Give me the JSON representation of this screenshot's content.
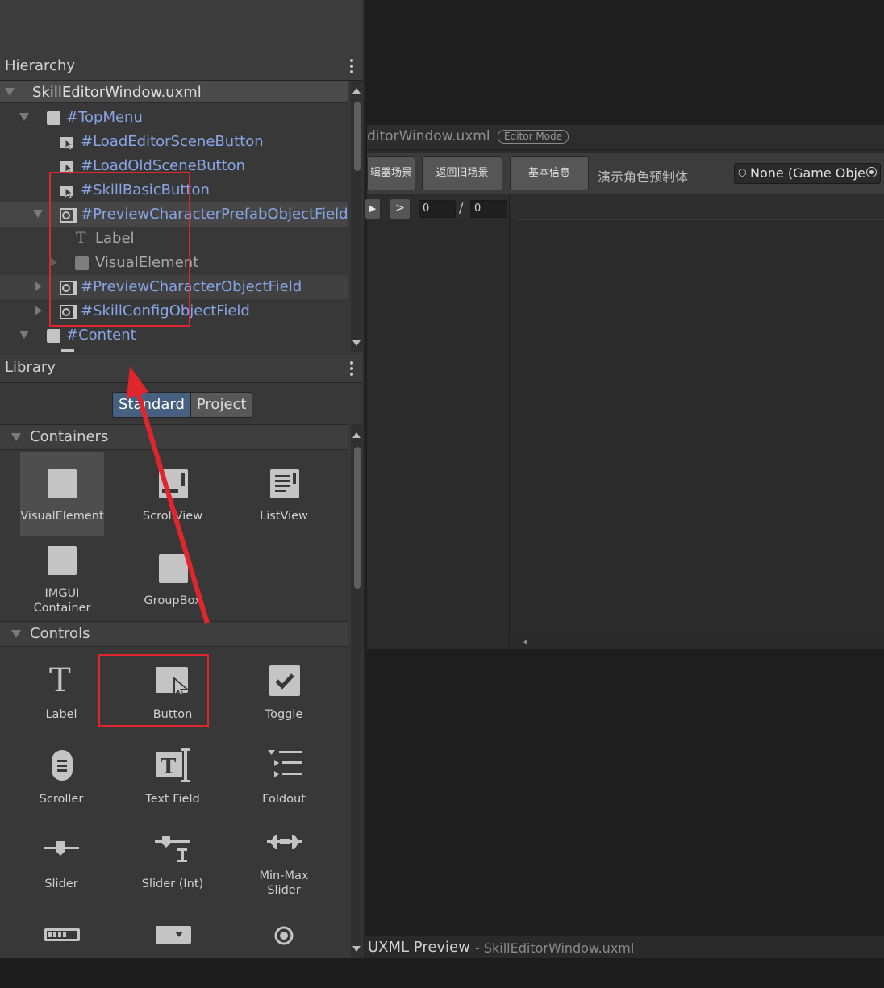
{
  "hierarchy": {
    "title": "Hierarchy",
    "root": "SkillEditorWindow.uxml",
    "rows": [
      {
        "label": "#TopMenu"
      },
      {
        "label": "#LoadEditorSceneButton"
      },
      {
        "label": "#LoadOldSceneButton"
      },
      {
        "label": "#SkillBasicButton"
      },
      {
        "label": "#PreviewCharacterPrefabObjectField"
      },
      {
        "label": "Label"
      },
      {
        "label": "VisualElement"
      },
      {
        "label": "#PreviewCharacterObjectField"
      },
      {
        "label": "#SkillConfigObjectField"
      },
      {
        "label": "#Content"
      }
    ]
  },
  "library": {
    "title": "Library",
    "tabs": {
      "standard": "Standard",
      "project": "Project"
    },
    "containers": {
      "title": "Containers",
      "items": [
        "VisualElement",
        "ScrollView",
        "ListView",
        "IMGUI Container",
        "GroupBox"
      ]
    },
    "controls": {
      "title": "Controls",
      "items": [
        "Label",
        "Button",
        "Toggle",
        "Scroller",
        "Text Field",
        "Foldout",
        "Slider",
        "Slider (Int)",
        "Min-Max Slider"
      ]
    }
  },
  "canvas": {
    "doc_title": "ditorWindow.uxml",
    "mode_badge": "Editor Mode",
    "toolbar": {
      "btn1": "辑器场景",
      "btn2": "返回旧场景",
      "btn3": "基本信息",
      "prefab_label": "演示角色预制体",
      "object_field": "None (Game Obje"
    },
    "controls": {
      "play": "▶",
      "next": ">",
      "current_frame": "0",
      "separator": "/",
      "total_frames": "0"
    }
  },
  "preview": {
    "title": "UXML Preview",
    "file": "- SkillEditorWindow.uxml"
  },
  "colors": {
    "accent": "#46607f",
    "highlight_box": "#e0262c",
    "node_text": "#88a6e6"
  }
}
